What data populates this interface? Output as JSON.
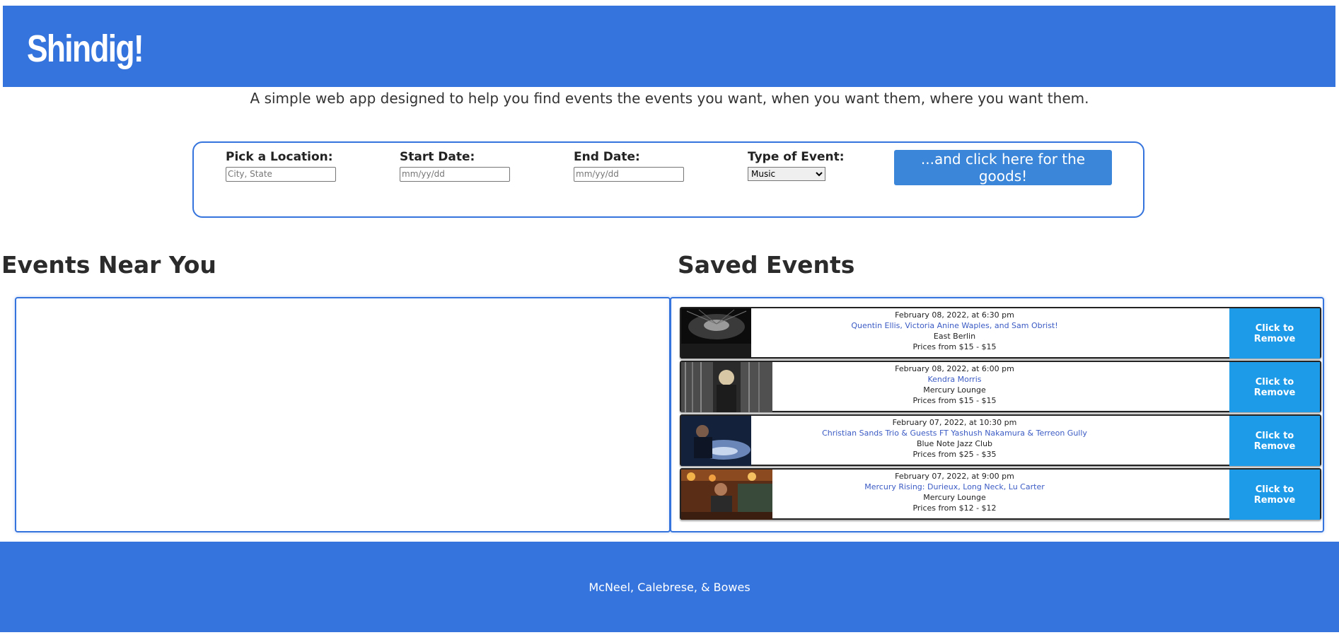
{
  "header": {
    "logo": "Shindig!"
  },
  "tagline": "A simple web app designed to help you find events the events you want, when you want them, where you want them.",
  "search": {
    "location_label": "Pick a Location:",
    "location_placeholder": "City, State",
    "start_label": "Start Date:",
    "start_placeholder": "mm/yy/dd",
    "end_label": "End Date:",
    "end_placeholder": "mm/yy/dd",
    "type_label": "Type of Event:",
    "type_selected": "Music",
    "button_label": "...and click here for the goods!"
  },
  "near": {
    "title": "Events Near You"
  },
  "saved": {
    "title": "Saved Events",
    "remove_label": "Click to Remove",
    "events": [
      {
        "date": "February 08, 2022, at 6:30 pm",
        "name": "Quentin Ellis, Victoria Anine Waples, and Sam Obrist!",
        "venue": "East Berlin",
        "price": "Prices from $15 - $15"
      },
      {
        "date": "February 08, 2022, at 6:00 pm",
        "name": "Kendra Morris",
        "venue": "Mercury Lounge",
        "price": "Prices from $15 - $15"
      },
      {
        "date": "February 07, 2022, at 10:30 pm",
        "name": "Christian Sands Trio & Guests FT Yashush Nakamura & Terreon Gully",
        "venue": "Blue Note Jazz Club",
        "price": "Prices from $25 - $35"
      },
      {
        "date": "February 07, 2022, at 9:00 pm",
        "name": "Mercury Rising: Durieux, Long Neck, Lu Carter",
        "venue": "Mercury Lounge",
        "price": "Prices from $12 - $12"
      }
    ]
  },
  "footer": {
    "credits": "McNeel, Calebrese, & Bowes"
  }
}
